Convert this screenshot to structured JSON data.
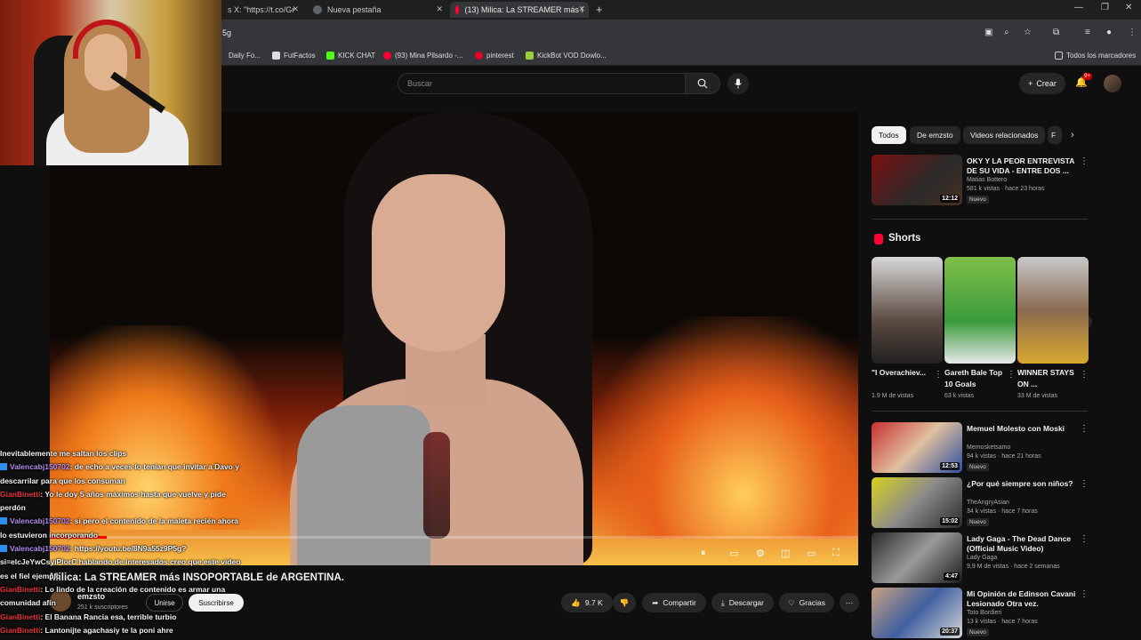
{
  "browser": {
    "tabs": [
      {
        "label": "s X: \"https://t.co/Gr"
      },
      {
        "label": "Nueva pestaña"
      },
      {
        "label": "(13) Milica: La STREAMER más I"
      }
    ],
    "url": "5g",
    "bookmarks": [
      {
        "label": "Daily Fo..."
      },
      {
        "label": "FutFactos"
      },
      {
        "label": "KICK CHAT"
      },
      {
        "label": "(93) Mina Pilsardo -..."
      },
      {
        "label": "pinterest"
      },
      {
        "label": "KickBot VOD Dowlo..."
      },
      {
        "label": "Todos los marcadores"
      }
    ]
  },
  "youtube": {
    "search_placeholder": "Buscar",
    "create_label": "Crear",
    "notif_count": "9+"
  },
  "video": {
    "progress": 0.07,
    "title": "Milica: La STREAMER más INSOPORTABLE de ARGENTINA.",
    "channel": "emzsto",
    "subs": "251 k suscriptores",
    "join": "Unirse",
    "subscribe": "Suscribirse",
    "likes": "9.7 K",
    "share": "Compartir",
    "download": "Descargar",
    "thanks": "Gracias"
  },
  "chat": [
    {
      "user": "",
      "text": "Inevitablemente me saltan los clips",
      "color": "#f3f3f3"
    },
    {
      "user": "Valencabj150702",
      "text": ": de echo a veces lo tenían que invitar a Davo y",
      "color": "#b48cf0"
    },
    {
      "user": "",
      "text": "descarrilar para que los consuman",
      "color": "#f3f3f3"
    },
    {
      "user": "GianBinetti",
      "text": ": Yo le doy 5 años máximos hasta que vuelve y pide",
      "color": "#e8333a"
    },
    {
      "user": "",
      "text": "perdón",
      "color": "#f3f3f3"
    },
    {
      "user": "Valencabj150702",
      "text": ": si pero el contenido de la maleta recién ahora",
      "color": "#b48cf0"
    },
    {
      "user": "",
      "text": "lo estuvieron incorporando",
      "color": "#f3f3f3"
    },
    {
      "user": "Valencabj150702",
      "text": ": https://youtu.be/8N9a55z9P5g?",
      "color": "#b48cf0"
    },
    {
      "user": "",
      "text": "si=elcJeYwCsyiPlorC hablando de interesados creo que este video",
      "color": "#f3f3f3"
    },
    {
      "user": "",
      "text": "es el fiel ejemplo",
      "color": "#f3f3f3"
    },
    {
      "user": "GianBinetti",
      "text": ": Lo lindo de la creación de contenido es armar una",
      "color": "#e8333a"
    },
    {
      "user": "",
      "text": "comunidad afín",
      "color": "#f3f3f3"
    },
    {
      "user": "GianBinetti",
      "text": ": El Banana Rancia esa, terrible turbio",
      "color": "#e8333a"
    },
    {
      "user": "GianBinetti",
      "text": ": Lantonijte agachasiy te la poni ahre",
      "color": "#e8333a"
    }
  ],
  "sidebar": {
    "chips": [
      "Todos",
      "De emzsto",
      "Videos relacionados",
      "F"
    ],
    "recs_top": [
      {
        "title": "OKY Y LA PEOR ENTREVISTA DE SU VIDA - ENTRE DOS ...",
        "channel": "Matias Bottero",
        "meta": "581 k vistas · hace 23 horas",
        "duration": "12:12",
        "badge": "Nuevo",
        "thumb": "linear-gradient(135deg,#7a1010,#2a2a2a 60%,#4a3020)"
      }
    ],
    "shorts_title": "Shorts",
    "shorts": [
      {
        "title": "\"I Overachiev...",
        "views": "1.9 M de vistas",
        "thumb": "linear-gradient(180deg,#d8d8d8,#5a4a40 60%,#202020)"
      },
      {
        "title": "Gareth Bale Top 10 Goals",
        "views": "63 k vistas",
        "thumb": "linear-gradient(180deg,#7fbf4a,#3a9a3a 60%,#e8e8e8)"
      },
      {
        "title": "WINNER STAYS ON ...",
        "views": "33 M de vistas",
        "thumb": "linear-gradient(180deg,#c9c9c9,#8a6a50 50%,#d8a830)"
      }
    ],
    "recs_bottom": [
      {
        "title": "Memuel Molesto con Moski",
        "channel": "Memosketsamo",
        "meta": "94 k vistas · hace 21 horas",
        "duration": "12:53",
        "badge": "Nuevo",
        "thumb": "linear-gradient(135deg,#c83030,#e0c0a0 50%,#3050a0)"
      },
      {
        "title": "¿Por qué siempre son niños?",
        "channel": "TheAngryAsian",
        "meta": "34 k vistas · hace 7 horas",
        "duration": "15:02",
        "badge": "Nuevo",
        "thumb": "linear-gradient(135deg,#d8d020,#8a8a8a 50%,#2a2a2a)"
      },
      {
        "title": "Lady Gaga - The Dead Dance (Official Music Video)",
        "channel": "Lady Gaga",
        "meta": "9,9 M de vistas · hace 2 semanas",
        "duration": "4:47",
        "badge": "",
        "thumb": "linear-gradient(135deg,#2a2a2a,#9a9a9a 50%,#1a1a1a)"
      },
      {
        "title": "Mi Opinión de Edinson Cavani Lesionado Otra vez.",
        "channel": "Toto Bordieri",
        "meta": "13 k vistas · hace 7 horas",
        "duration": "20:37",
        "badge": "Nuevo",
        "thumb": "linear-gradient(135deg,#c8a080,#4060a0 50%,#d8d8d8)"
      }
    ]
  }
}
